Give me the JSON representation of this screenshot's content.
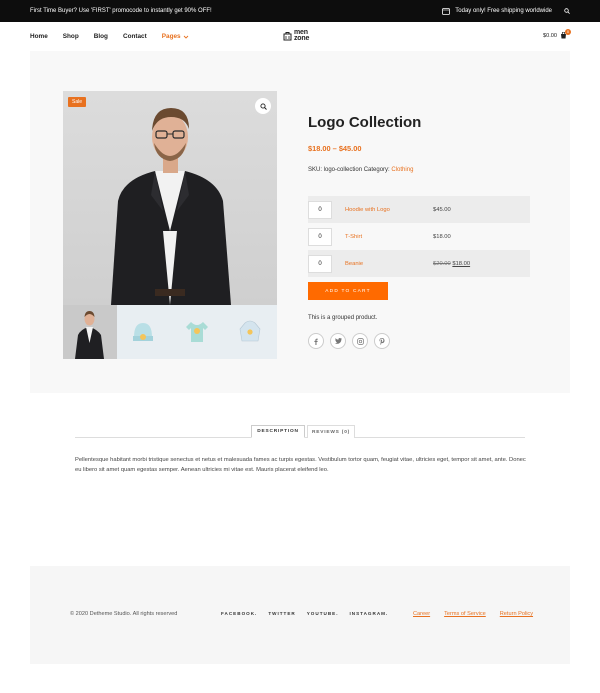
{
  "topbar": {
    "promo": "First Time Buyer? Use 'FIRST' promocode to instantly get 90% OFF!",
    "shipping": "Today only! Free shipping worldwide"
  },
  "nav": {
    "items": [
      "Home",
      "Shop",
      "Blog",
      "Contact",
      "Pages"
    ],
    "logo_line1": "men",
    "logo_line2": "zone",
    "cart_total": "$0.00",
    "cart_count": "0"
  },
  "product": {
    "sale_badge": "Sale",
    "title": "Logo Collection",
    "price_range": "$18.00 – $45.00",
    "sku_label": "SKU: logo-collection Category:",
    "category": "Clothing",
    "grouped_items": [
      {
        "qty": "0",
        "name": "Hoodie with Logo",
        "price": "$45.00"
      },
      {
        "qty": "0",
        "name": "T-Shirt",
        "price": "$18.00"
      },
      {
        "qty": "0",
        "name": "Beanie",
        "old_price": "$20.00",
        "price": "$18.00"
      }
    ],
    "add_to_cart": "ADD TO CART",
    "grouped_note": "This is a grouped product."
  },
  "tabs": {
    "description": "DESCRIPTION",
    "reviews": "REVIEWS (0)"
  },
  "description": "Pellentesque habitant morbi tristique senectus et netus et malesuada fames ac turpis egestas. Vestibulum tortor quam, feugiat vitae, ultricies eget, tempor sit amet, ante. Donec eu libero sit amet quam egestas semper. Aenean ultricies mi vitae est. Mauris placerat eleifend leo.",
  "footer": {
    "copyright": "© 2020 Detheme Studio. All rights reserved",
    "social": [
      "FACEBOOK.",
      "TWITTER",
      "YOUTUBE.",
      "INSTAGRAM."
    ],
    "links": [
      "Career",
      "Terms of Service",
      "Return Policy"
    ]
  },
  "colors": {
    "accent": "#e8711f",
    "button": "#ff6a00"
  }
}
